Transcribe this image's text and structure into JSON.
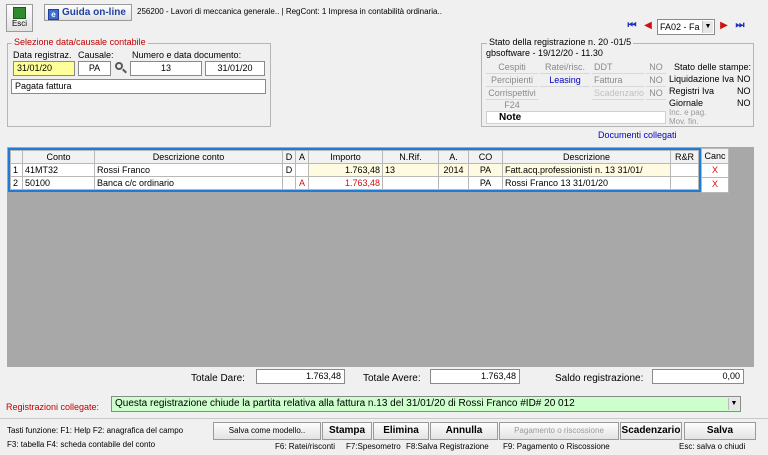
{
  "toolbar": {
    "exit_label": "Esci",
    "help_label": "Guida on-line",
    "title": "256200 - Lavori di meccanica generale.. | RegCont: 1 Impresa  in contabilità ordinaria..",
    "nav_combo": "FA02 - Fa"
  },
  "selection": {
    "group_title": "Selezione data/causale contabile",
    "date_label": "Data registraz.",
    "causal_label": "Causale:",
    "doc_label": "Numero e data documento:",
    "date_value": "31/01/20",
    "causal_value": "PA",
    "doc_number": "13",
    "doc_date": "31/01/20",
    "description": "Pagata fattura"
  },
  "status": {
    "title": "Stato della registrazione n. 20   -01/5",
    "subtitle": "gbsoftware - 19/12/20   - 11.30",
    "cells": {
      "cespiti": "Cespiti",
      "ratei": "Ratei/risc.",
      "ddt": "DDT",
      "ddt_flag": "NO",
      "percipienti": "Percipienti",
      "leasing": "Leasing",
      "fattura": "Fattura",
      "fattura_flag": "NO",
      "corrispettivi": "Corrispettivi",
      "scadenzario": "Scadenzario",
      "scadenzario_flag": "NO",
      "f24": "F24",
      "note": "Note"
    },
    "prints_title": "Stato delle stampe:",
    "prints": [
      {
        "label": "Liquidazione Iva",
        "value": "NO"
      },
      {
        "label": "Registri Iva",
        "value": "NO"
      },
      {
        "label": "Giornale",
        "value": "NO"
      },
      {
        "label": "Inc. e pag.",
        "value": ""
      },
      {
        "label": "Mov. fin.",
        "value": ""
      }
    ]
  },
  "linked_docs_label": "Documenti collegati",
  "grid": {
    "headers": [
      "",
      "Conto",
      "Descrizione conto",
      "D",
      "A",
      "Importo",
      "N.Rif.",
      "A.",
      "CO",
      "Descrizione",
      "R&R",
      "Canc"
    ],
    "rows": [
      {
        "n": "1",
        "conto": "41MT32",
        "descr": "Rossi Franco",
        "d": "D",
        "a": "",
        "importo": "1.763,48",
        "nrif": "13",
        "anno": "2014",
        "co": "PA",
        "descrizione": "Fatt.acq.professionisti n. 13 31/01/",
        "rr": "",
        "canc": "X"
      },
      {
        "n": "2",
        "conto": "50100",
        "descr": "Banca c/c ordinario",
        "d": "",
        "a": "A",
        "importo": "1.763,48",
        "nrif": "",
        "anno": "",
        "co": "PA",
        "descrizione": "Rossi Franco 13 31/01/20",
        "rr": "",
        "canc": "X"
      }
    ]
  },
  "totals": {
    "dare_label": "Totale Dare:",
    "dare_value": "1.763,48",
    "avere_label": "Totale Avere:",
    "avere_value": "1.763,48",
    "saldo_label": "Saldo registrazione:",
    "saldo_value": "0,00"
  },
  "linked": {
    "label": "Registrazioni collegate:",
    "value": "Questa registrazione chiude la partita relativa alla fattura n.13 del 31/01/20     di Rossi Franco #ID# 20    012"
  },
  "footer": {
    "keys_line1": "Tasti funzione:  F1: Help  F2: anagrafica del campo",
    "keys_line2": "F3: tabella   F4: scheda contabile del conto",
    "save_model": "Salva come modello..",
    "stampa": "Stampa",
    "elimina": "Elimina",
    "annulla": "Annulla",
    "pagamento": "Pagamento o riscossione",
    "scadenzario": "Scadenzario",
    "salva": "Salva",
    "f6": "F6: Ratei/risconti",
    "f7": "F7:Spesometro",
    "f8": "F8:Salva Registrazione",
    "f9": "F9: Pagamento o Riscossione",
    "esc": "Esc: salva o chiudi"
  },
  "colors": {
    "accent_red": "#c00000",
    "link_blue": "#0000c0",
    "grid_border": "#1e7bd6",
    "linked_bg": "#ccffcc",
    "date_bg": "#ffff99"
  }
}
